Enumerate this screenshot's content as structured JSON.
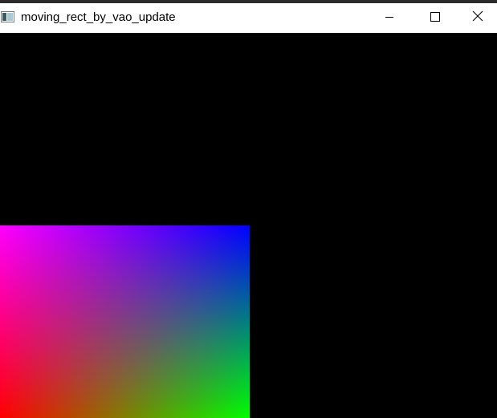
{
  "window": {
    "title": "moving_rect_by_vao_update",
    "app_icon": "opengl-window-icon",
    "controls": {
      "minimize_icon": "minimize-icon",
      "maximize_icon": "maximize-icon",
      "close_icon": "close-icon"
    }
  },
  "scene": {
    "background_color": "#000000",
    "rect": {
      "corner_colors": {
        "top_left": "#ff00ff",
        "top_right": "#0000ff",
        "bottom_left": "#ff0000",
        "bottom_right": "#00ff00"
      }
    }
  }
}
